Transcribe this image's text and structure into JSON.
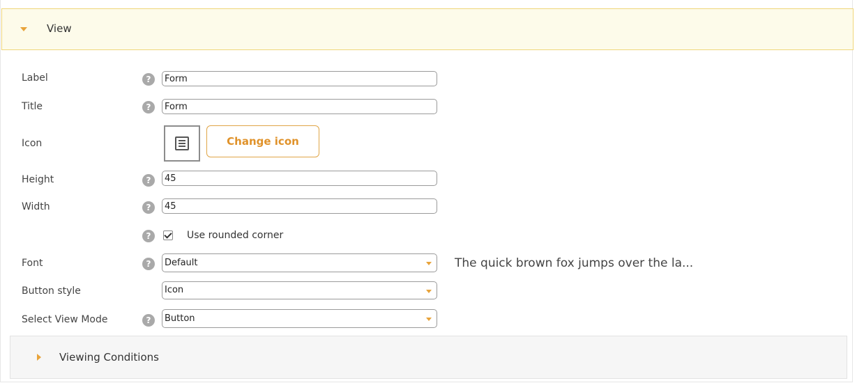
{
  "view_section": {
    "title": "View",
    "expanded": true
  },
  "help_glyph": "?",
  "fields": {
    "label": {
      "label": "Label",
      "value": "Form"
    },
    "title": {
      "label": "Title",
      "value": "Form"
    },
    "icon": {
      "label": "Icon",
      "icon_name": "document-list-icon",
      "change_button": "Change icon"
    },
    "height": {
      "label": "Height",
      "value": "45"
    },
    "width": {
      "label": "Width",
      "value": "45"
    },
    "rounded_corner": {
      "label": "Use rounded corner",
      "checked": true
    },
    "font": {
      "label": "Font",
      "value": "Default",
      "preview": "The quick brown fox jumps over the la..."
    },
    "button_style": {
      "label": "Button style",
      "value": "Icon"
    },
    "view_mode": {
      "label": "Select View Mode",
      "value": "Button"
    }
  },
  "viewing_conditions": {
    "title": "Viewing Conditions",
    "expanded": false
  },
  "colors": {
    "accent": "#e8a33a",
    "header_bg": "#fdfbea",
    "header_border": "#f0d67a",
    "button_text": "#e0922a"
  }
}
